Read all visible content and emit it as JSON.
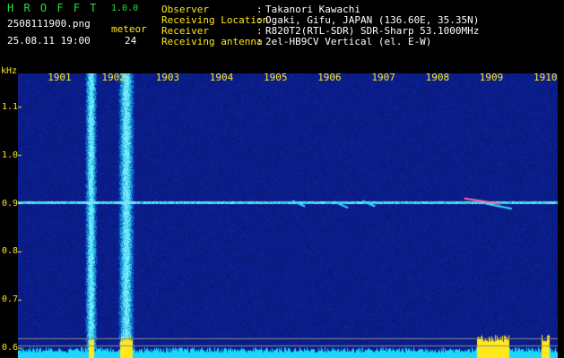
{
  "app": {
    "name": "H R O F F T",
    "version": "1.0.0"
  },
  "file": {
    "name": "2508111900.png",
    "timestamp": "25.08.11 19:00"
  },
  "counter": {
    "label": "meteor",
    "value": "24"
  },
  "station": [
    {
      "key": "Observer",
      "value": "Takanori Kawachi"
    },
    {
      "key": "Receiving Location",
      "value": "Ogaki, Gifu, JAPAN (136.60E, 35.35N)"
    },
    {
      "key": "Receiver",
      "value": "R820T2(RTL-SDR) SDR-Sharp 53.1000MHz"
    },
    {
      "key": "Receiving antenna",
      "value": "2el-HB9CV Vertical (el. E-W)"
    }
  ],
  "colors": {
    "accent_title": "#22e03a",
    "label_yellow": "#ffe81c",
    "background_blue": "#08106a",
    "signal_cyan": "#33ddff",
    "baseline_cyan": "#19d8ff",
    "hot_yellow": "#ffe81c"
  },
  "chart_data": {
    "type": "heatmap",
    "ylabel": "kHz",
    "y_ticks": [
      "1.1",
      "1.0",
      "0.9",
      "0.8",
      "0.7",
      "0.6"
    ],
    "x_ticks": [
      "1901",
      "1902",
      "1903",
      "1904",
      "1905",
      "1906",
      "1907",
      "1908",
      "1909",
      "1910"
    ],
    "ylim": [
      0.58,
      1.17
    ],
    "xlim_minutes": [
      0,
      10
    ],
    "carrier_khz": 0.903,
    "broadband_bursts_minutes": [
      1.35,
      2.0
    ],
    "meteor_echoes": [
      {
        "minute": 8.6,
        "khz": 0.905,
        "strength": "strong"
      },
      {
        "minute": 8.9,
        "khz": 0.895,
        "strength": "medium"
      },
      {
        "minute": 5.2,
        "khz": 0.9,
        "strength": "weak"
      },
      {
        "minute": 6.0,
        "khz": 0.897,
        "strength": "weak"
      },
      {
        "minute": 6.5,
        "khz": 0.9,
        "strength": "weak"
      }
    ]
  }
}
